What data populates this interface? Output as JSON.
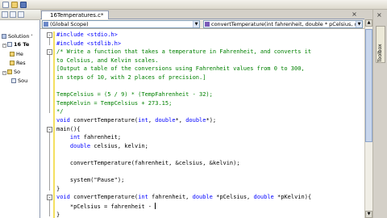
{
  "editor": {
    "tab_title": "16Temperatures.c*",
    "scope_combo": "(Global Scope)",
    "member_combo": "convertTemperature(int fahrenheit, double * pCelsius, double * pKelvin)"
  },
  "solution_explorer": {
    "items": [
      "Solution '",
      "16 Te",
      "He",
      "Res",
      "So",
      "Sou"
    ]
  },
  "right_panel": {
    "toolbox_label": "Toolbox"
  },
  "code": {
    "lines": [
      [
        {
          "t": "#include <stdio.h>",
          "c": "kw"
        }
      ],
      [
        {
          "t": "#include <stdlib.h>",
          "c": "kw"
        }
      ],
      [
        {
          "t": "/* Write a function that takes a temperature in Fahrenheit, and converts it",
          "c": "cm"
        }
      ],
      [
        {
          "t": "to Celsius, and Kelvin scales.",
          "c": "cm"
        }
      ],
      [
        {
          "t": "[Output a table of the conversions using Fahrenheit values from 0 to 300,",
          "c": "cm"
        }
      ],
      [
        {
          "t": "in steps of 10, with 2 places of precision.]",
          "c": "cm"
        }
      ],
      [
        {
          "t": "",
          "c": "tx"
        }
      ],
      [
        {
          "t": "TempCelsius = (5 / 9) * (TempFahrenheit - 32);",
          "c": "cm"
        }
      ],
      [
        {
          "t": "TempKelvin = TempCelsius + 273.15;",
          "c": "cm"
        }
      ],
      [
        {
          "t": "*/",
          "c": "cm"
        }
      ],
      [
        {
          "t": "void",
          "c": "kw"
        },
        {
          "t": " convertTemperature(",
          "c": "tx"
        },
        {
          "t": "int",
          "c": "kw"
        },
        {
          "t": ", ",
          "c": "tx"
        },
        {
          "t": "double",
          "c": "kw"
        },
        {
          "t": "*, ",
          "c": "tx"
        },
        {
          "t": "double",
          "c": "kw"
        },
        {
          "t": "*);",
          "c": "tx"
        }
      ],
      [
        {
          "t": "main(){",
          "c": "tx"
        }
      ],
      [
        {
          "t": "    ",
          "c": "tx"
        },
        {
          "t": "int",
          "c": "kw"
        },
        {
          "t": " fahrenheit;",
          "c": "tx"
        }
      ],
      [
        {
          "t": "    ",
          "c": "tx"
        },
        {
          "t": "double",
          "c": "kw"
        },
        {
          "t": " celsius, kelvin;",
          "c": "tx"
        }
      ],
      [
        {
          "t": "",
          "c": "tx"
        }
      ],
      [
        {
          "t": "    convertTemperature(fahrenheit, &celsius, &kelvin);",
          "c": "tx"
        }
      ],
      [
        {
          "t": "",
          "c": "tx"
        }
      ],
      [
        {
          "t": "    system(\"Pause\");",
          "c": "tx"
        }
      ],
      [
        {
          "t": "}",
          "c": "tx"
        }
      ],
      [
        {
          "t": "void",
          "c": "kw"
        },
        {
          "t": " convertTemperature(",
          "c": "tx"
        },
        {
          "t": "int",
          "c": "kw"
        },
        {
          "t": " fahrenheit, ",
          "c": "tx"
        },
        {
          "t": "double",
          "c": "kw"
        },
        {
          "t": " *pCelsius, ",
          "c": "tx"
        },
        {
          "t": "double",
          "c": "kw"
        },
        {
          "t": " *pKelvin){",
          "c": "tx"
        }
      ],
      [
        {
          "t": "    *pCelsius = fahrenheit - ",
          "c": "tx"
        }
      ],
      [
        {
          "t": "}",
          "c": "tx"
        }
      ]
    ]
  }
}
